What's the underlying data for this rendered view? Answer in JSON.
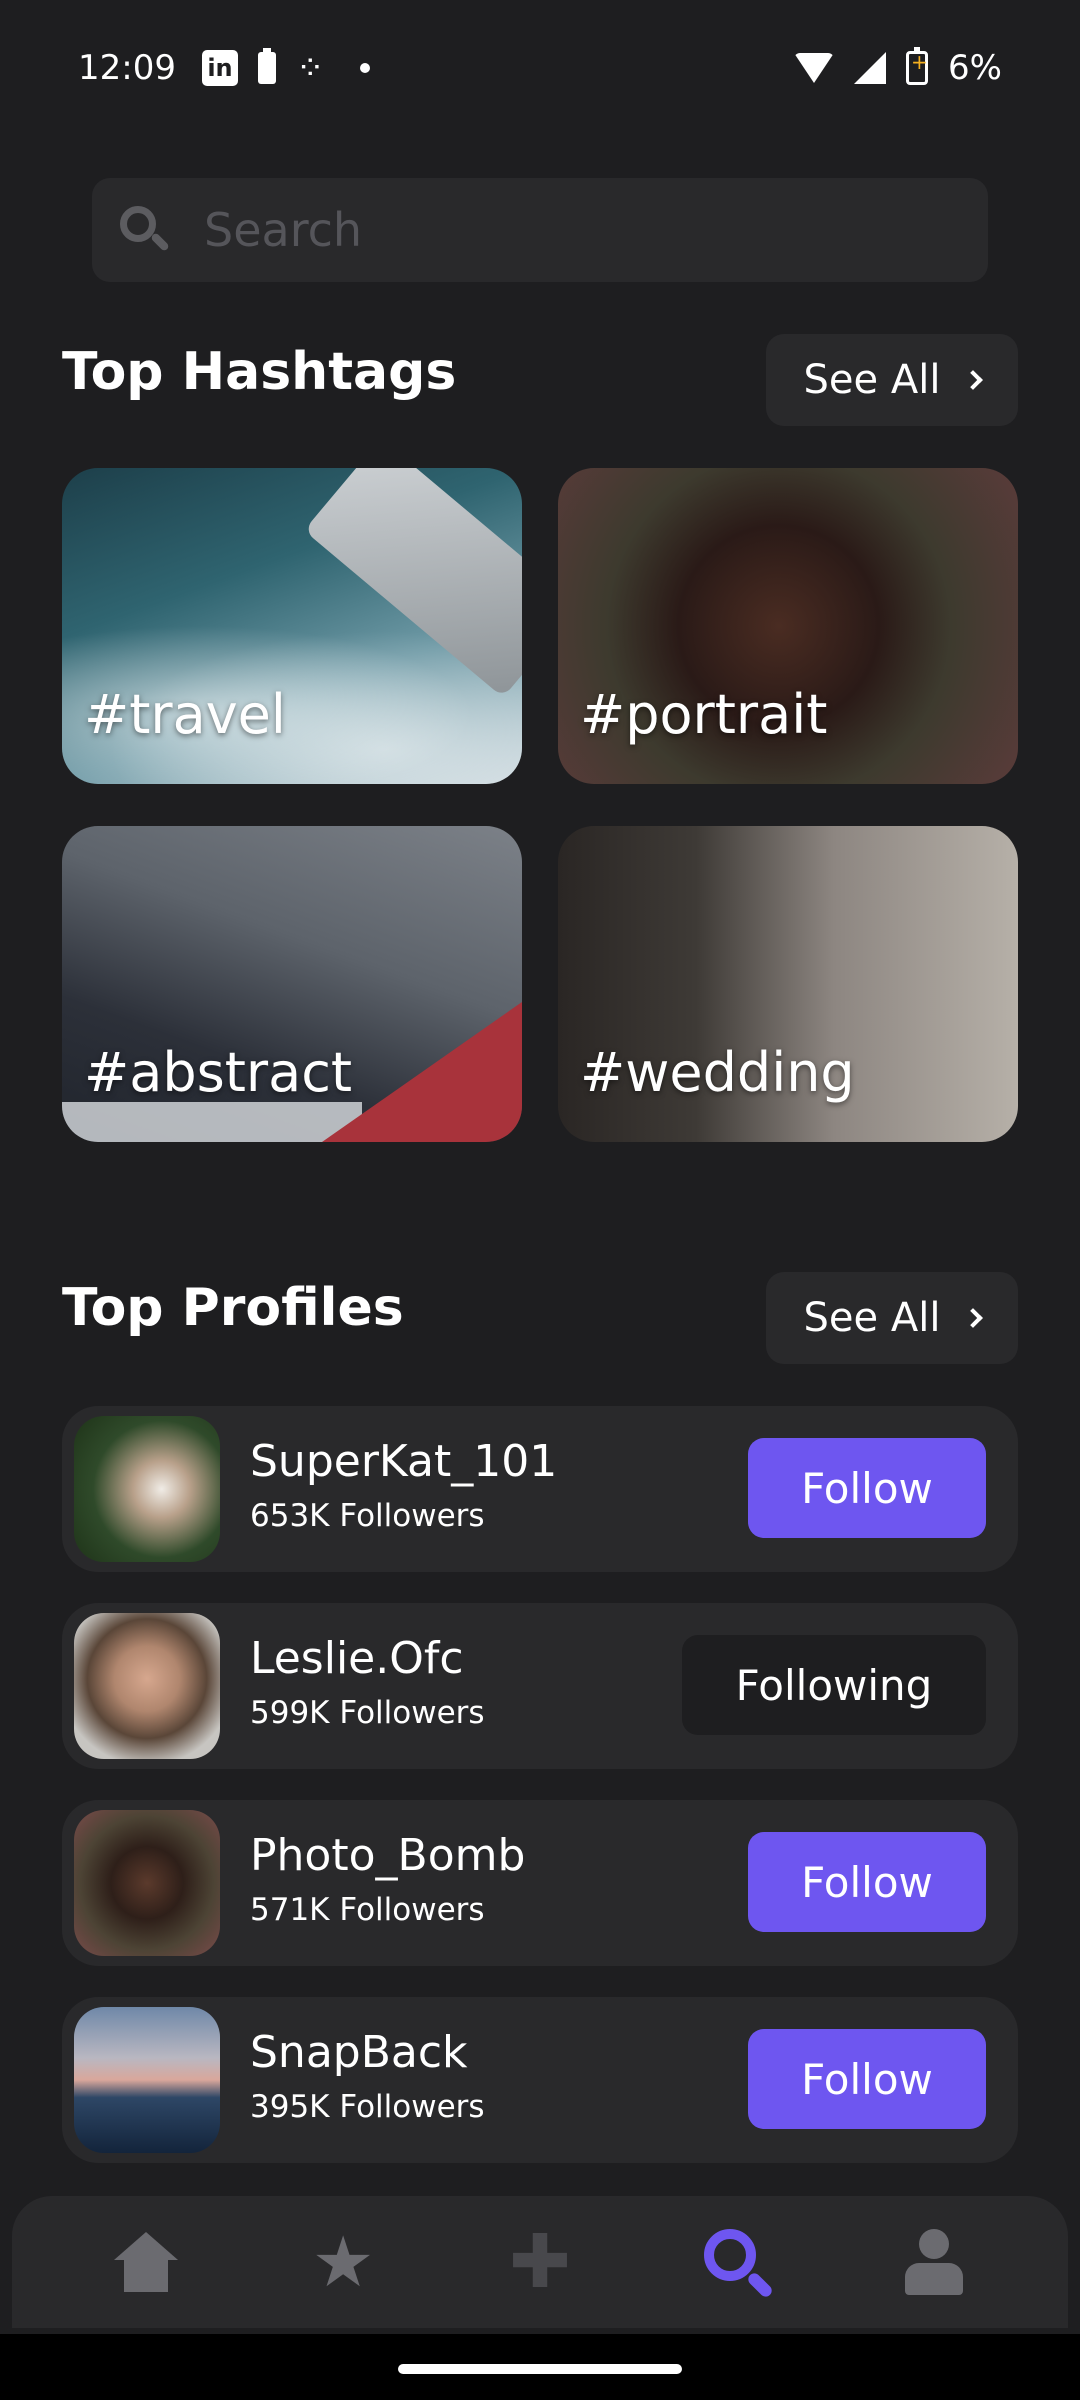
{
  "status_bar": {
    "time": "12:09",
    "linkedin_label": "in",
    "battery_percent": "6%",
    "icons": [
      "linkedin-icon",
      "battery-icon",
      "footprint-icon",
      "dot-icon",
      "wifi-icon",
      "signal-icon",
      "battery-charging-icon"
    ]
  },
  "search": {
    "placeholder": "Search",
    "icon": "search-icon"
  },
  "hashtags": {
    "title": "Top Hashtags",
    "see_all_label": "See All",
    "items": [
      {
        "label": "#travel"
      },
      {
        "label": "#portrait"
      },
      {
        "label": "#abstract"
      },
      {
        "label": "#wedding"
      }
    ]
  },
  "profiles": {
    "title": "Top Profiles",
    "see_all_label": "See All",
    "items": [
      {
        "name": "SuperKat_101",
        "followers": "653K Followers",
        "button": "Follow",
        "following": false
      },
      {
        "name": "Leslie.Ofc",
        "followers": "599K Followers",
        "button": "Following",
        "following": true
      },
      {
        "name": "Photo_Bomb",
        "followers": "571K Followers",
        "button": "Follow",
        "following": false
      },
      {
        "name": "SnapBack",
        "followers": "395K Followers",
        "button": "Follow",
        "following": false
      }
    ]
  },
  "bottom_nav": {
    "items": [
      "home-icon",
      "star-icon",
      "plus-icon",
      "search-icon",
      "user-icon"
    ],
    "active": "search-icon"
  },
  "colors": {
    "background": "#1e1e20",
    "card": "#29292b",
    "accent": "#6e56f0",
    "inactive_icon": "#6b6b70"
  }
}
